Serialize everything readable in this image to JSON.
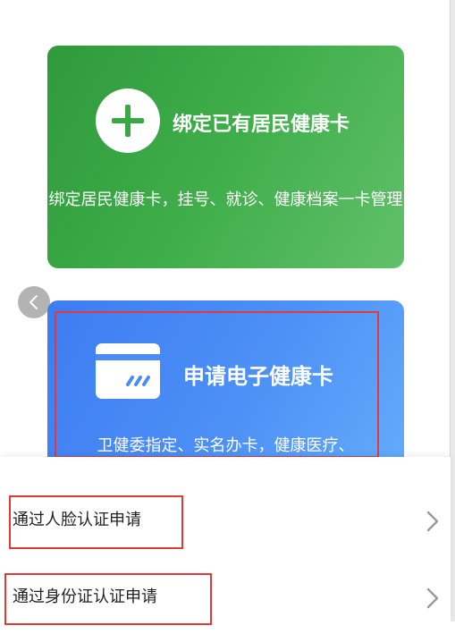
{
  "bind_card": {
    "title": "绑定已有居民健康卡",
    "description": "绑定居民健康卡，挂号、就诊、健康档案一卡管理",
    "icon": "plus-icon",
    "color": "#3aa845"
  },
  "apply_card": {
    "title": "申请电子健康卡",
    "description": "卫健委指定、实名办卡，健康医疗、",
    "icon": "health-card-icon",
    "color": "#4a8cf5"
  },
  "nav": {
    "back_icon": "chevron-left-icon"
  },
  "sheet": {
    "options": [
      {
        "label": "通过人脸认证申请",
        "icon": "chevron-right-icon"
      },
      {
        "label": "通过身份证认证申请",
        "icon": "chevron-right-icon"
      }
    ]
  },
  "highlight_color": "#e03a3a"
}
